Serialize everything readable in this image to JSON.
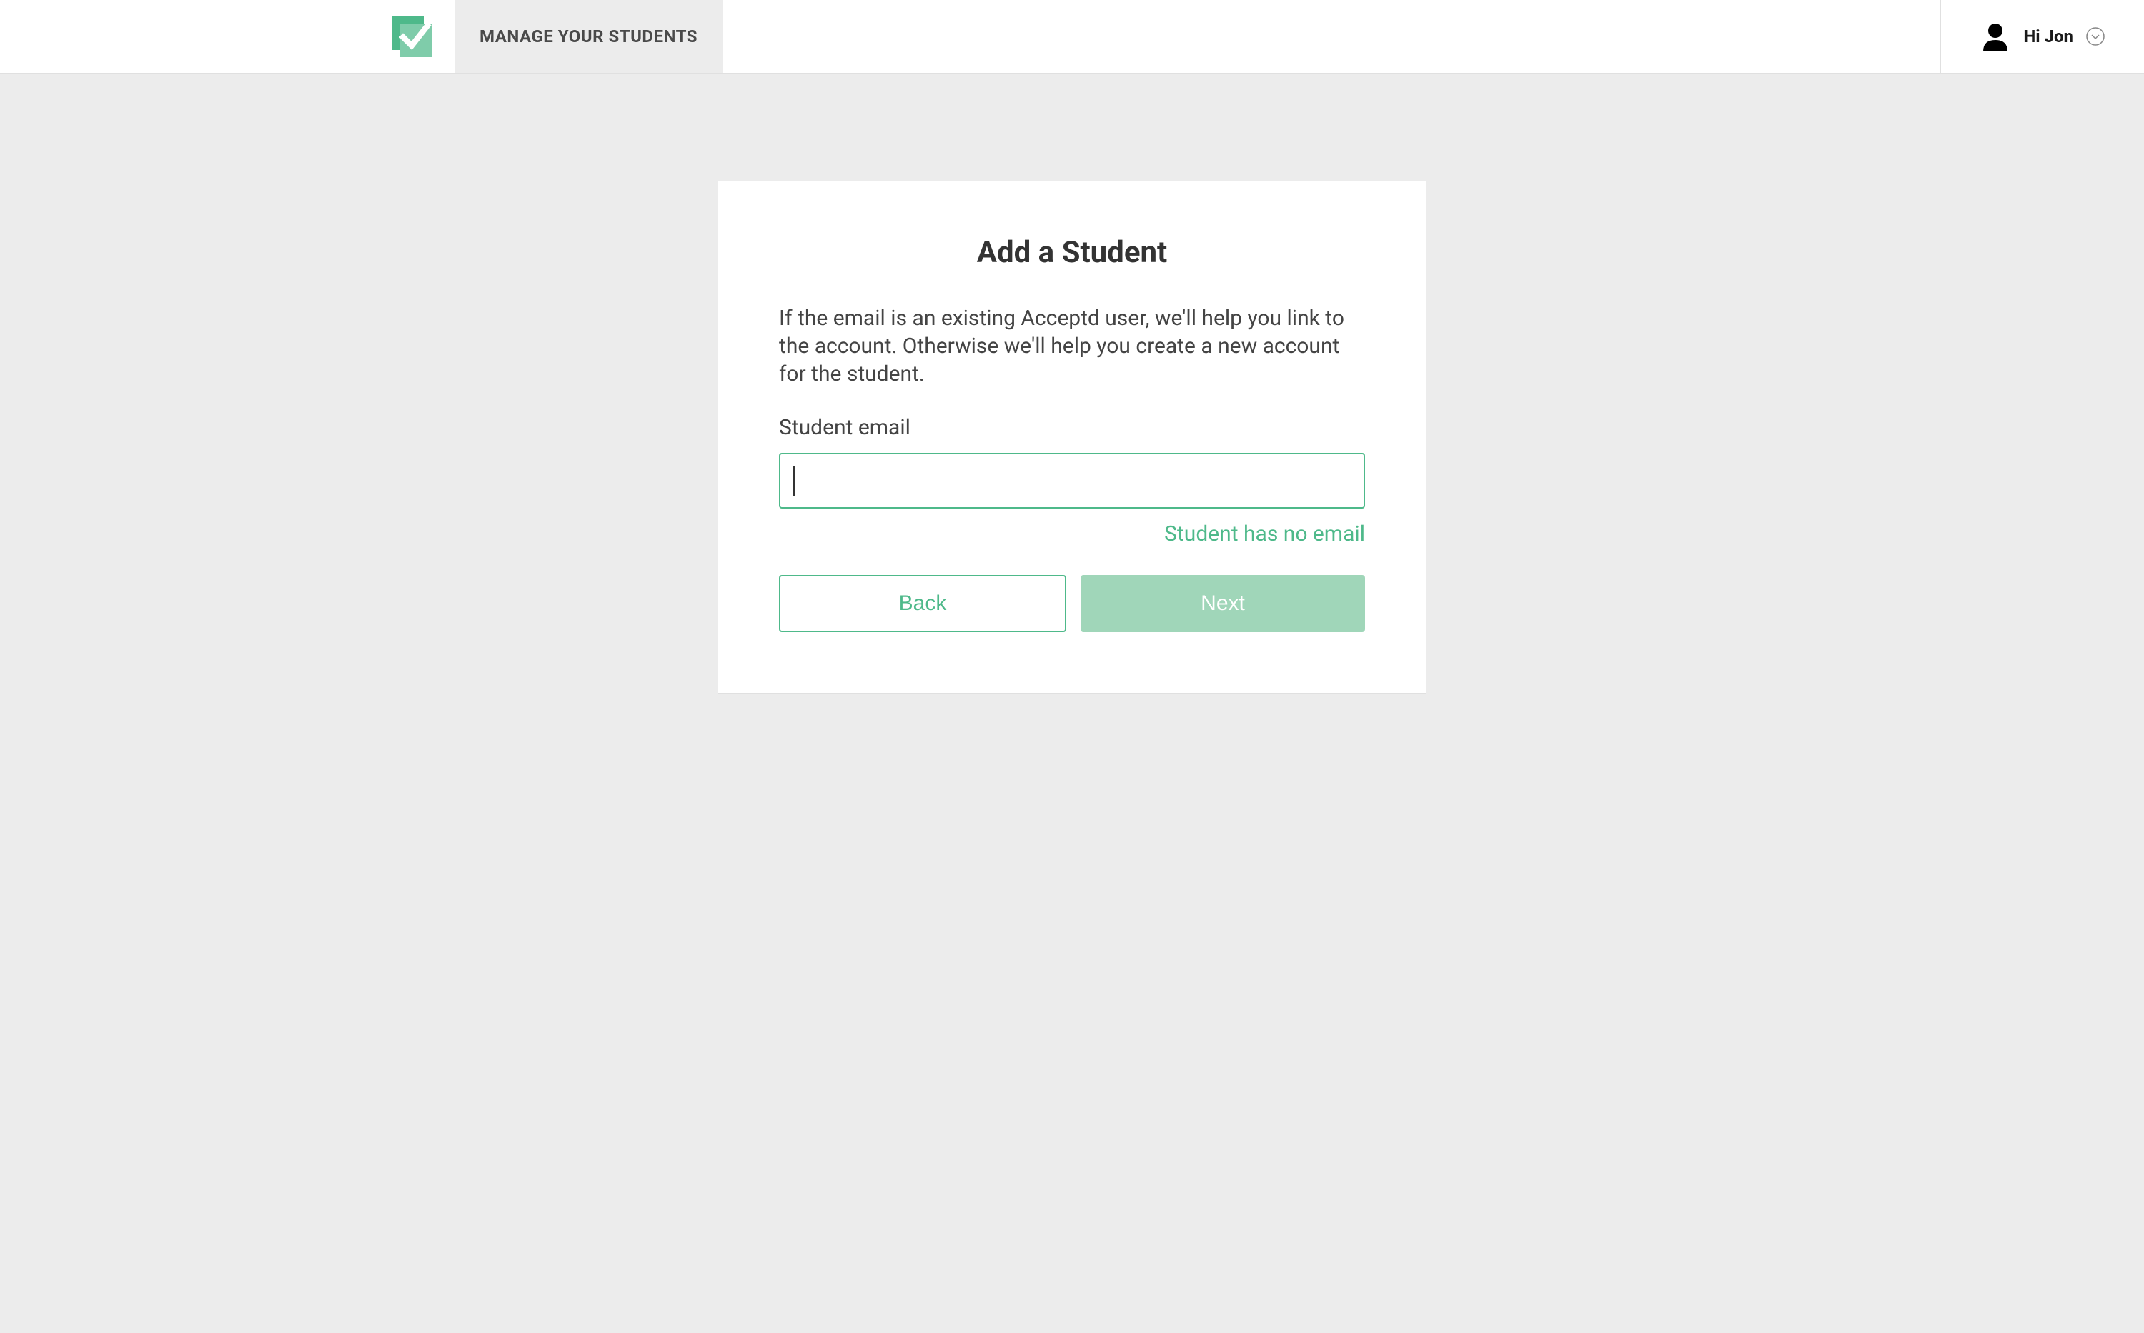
{
  "header": {
    "nav_tab": "MANAGE YOUR STUDENTS",
    "user_greeting": "Hi Jon"
  },
  "card": {
    "title": "Add a Student",
    "description": "If the email is an existing Acceptd user, we'll help you link to the account. Otherwise we'll help you create a new account for the student.",
    "email_label": "Student email",
    "email_value": "",
    "no_email_link": "Student has no email",
    "back_button": "Back",
    "next_button": "Next"
  }
}
